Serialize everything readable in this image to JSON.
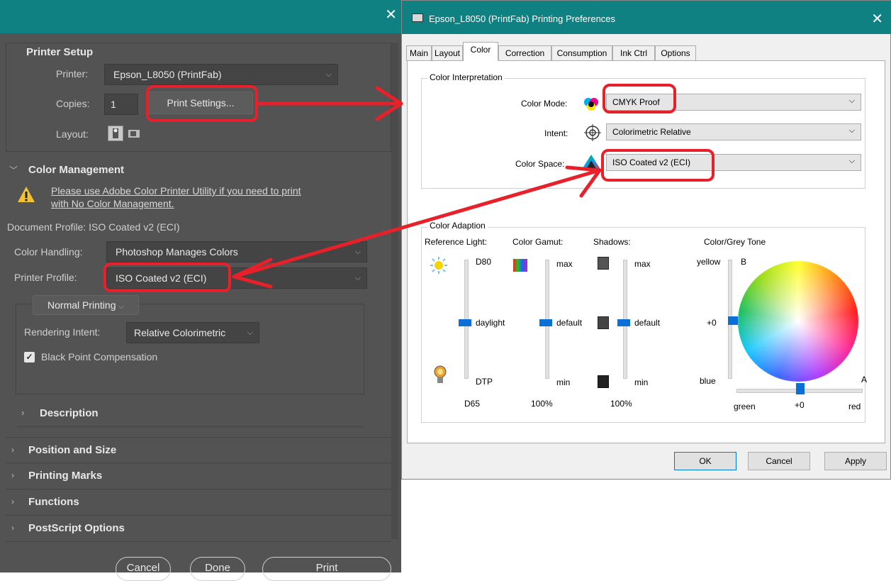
{
  "left_panel": {
    "close_glyph": "✕",
    "printer_setup": {
      "heading": "Printer Setup",
      "printer_label": "Printer:",
      "printer_value": "Epson_L8050 (PrintFab)",
      "copies_label": "Copies:",
      "copies_value": "1",
      "print_settings_button": "Print Settings...",
      "layout_label": "Layout:"
    },
    "color_management": {
      "heading": "Color Management",
      "warning_text_line1": "Please use Adobe Color Printer Utility if you need to print",
      "warning_text_line2": "with No Color Management.",
      "document_profile": "Document Profile: ISO Coated v2 (ECI)",
      "color_handling_label": "Color Handling:",
      "color_handling_value": "Photoshop Manages Colors",
      "printer_profile_label": "Printer Profile:",
      "printer_profile_value": "ISO Coated v2 (ECI)",
      "normal_printing": "Normal Printing",
      "rendering_intent_label": "Rendering Intent:",
      "rendering_intent_value": "Relative Colorimetric",
      "bpc_label": "Black Point Compensation"
    },
    "description": "Description",
    "sections": [
      "Position and Size",
      "Printing Marks",
      "Functions",
      "PostScript Options"
    ],
    "buttons": {
      "cancel": "Cancel",
      "done": "Done",
      "print": "Print"
    }
  },
  "dialog": {
    "title": "Epson_L8050 (PrintFab) Printing Preferences",
    "close_glyph": "✕",
    "tabs": [
      "Main",
      "Layout",
      "Color",
      "Correction",
      "Consumption",
      "Ink Ctrl",
      "Options"
    ],
    "active_tab": "Color",
    "color_interpretation": {
      "group_title": "Color Interpretation",
      "color_mode_label": "Color Mode:",
      "color_mode_value": "CMYK Proof",
      "intent_label": "Intent:",
      "intent_value": "Colorimetric Relative",
      "color_space_label": "Color Space:",
      "color_space_value": "ISO Coated v2 (ECI)"
    },
    "color_adaption": {
      "group_title": "Color Adaption",
      "reference_light": {
        "title": "Reference Light:",
        "top": "D80",
        "middle": "daylight",
        "bottom": "DTP",
        "footer": "D65",
        "level": 0.5
      },
      "color_gamut": {
        "title": "Color Gamut:",
        "top": "max",
        "middle": "default",
        "bottom": "min",
        "footer": "100%",
        "level": 0.5
      },
      "shadows": {
        "title": "Shadows:",
        "top": "max",
        "middle": "default",
        "bottom": "min",
        "footer": "100%",
        "level": 0.5
      },
      "tone": {
        "title": "Color/Grey Tone",
        "yellow": "yellow",
        "b_axis": "B",
        "plus0_v": "+0",
        "blue": "blue",
        "a_axis": "A",
        "green": "green",
        "plus0_h": "+0",
        "red": "red"
      }
    },
    "buttons": {
      "ok": "OK",
      "cancel": "Cancel",
      "apply": "Apply"
    }
  },
  "annotation_color": "#e8202a"
}
